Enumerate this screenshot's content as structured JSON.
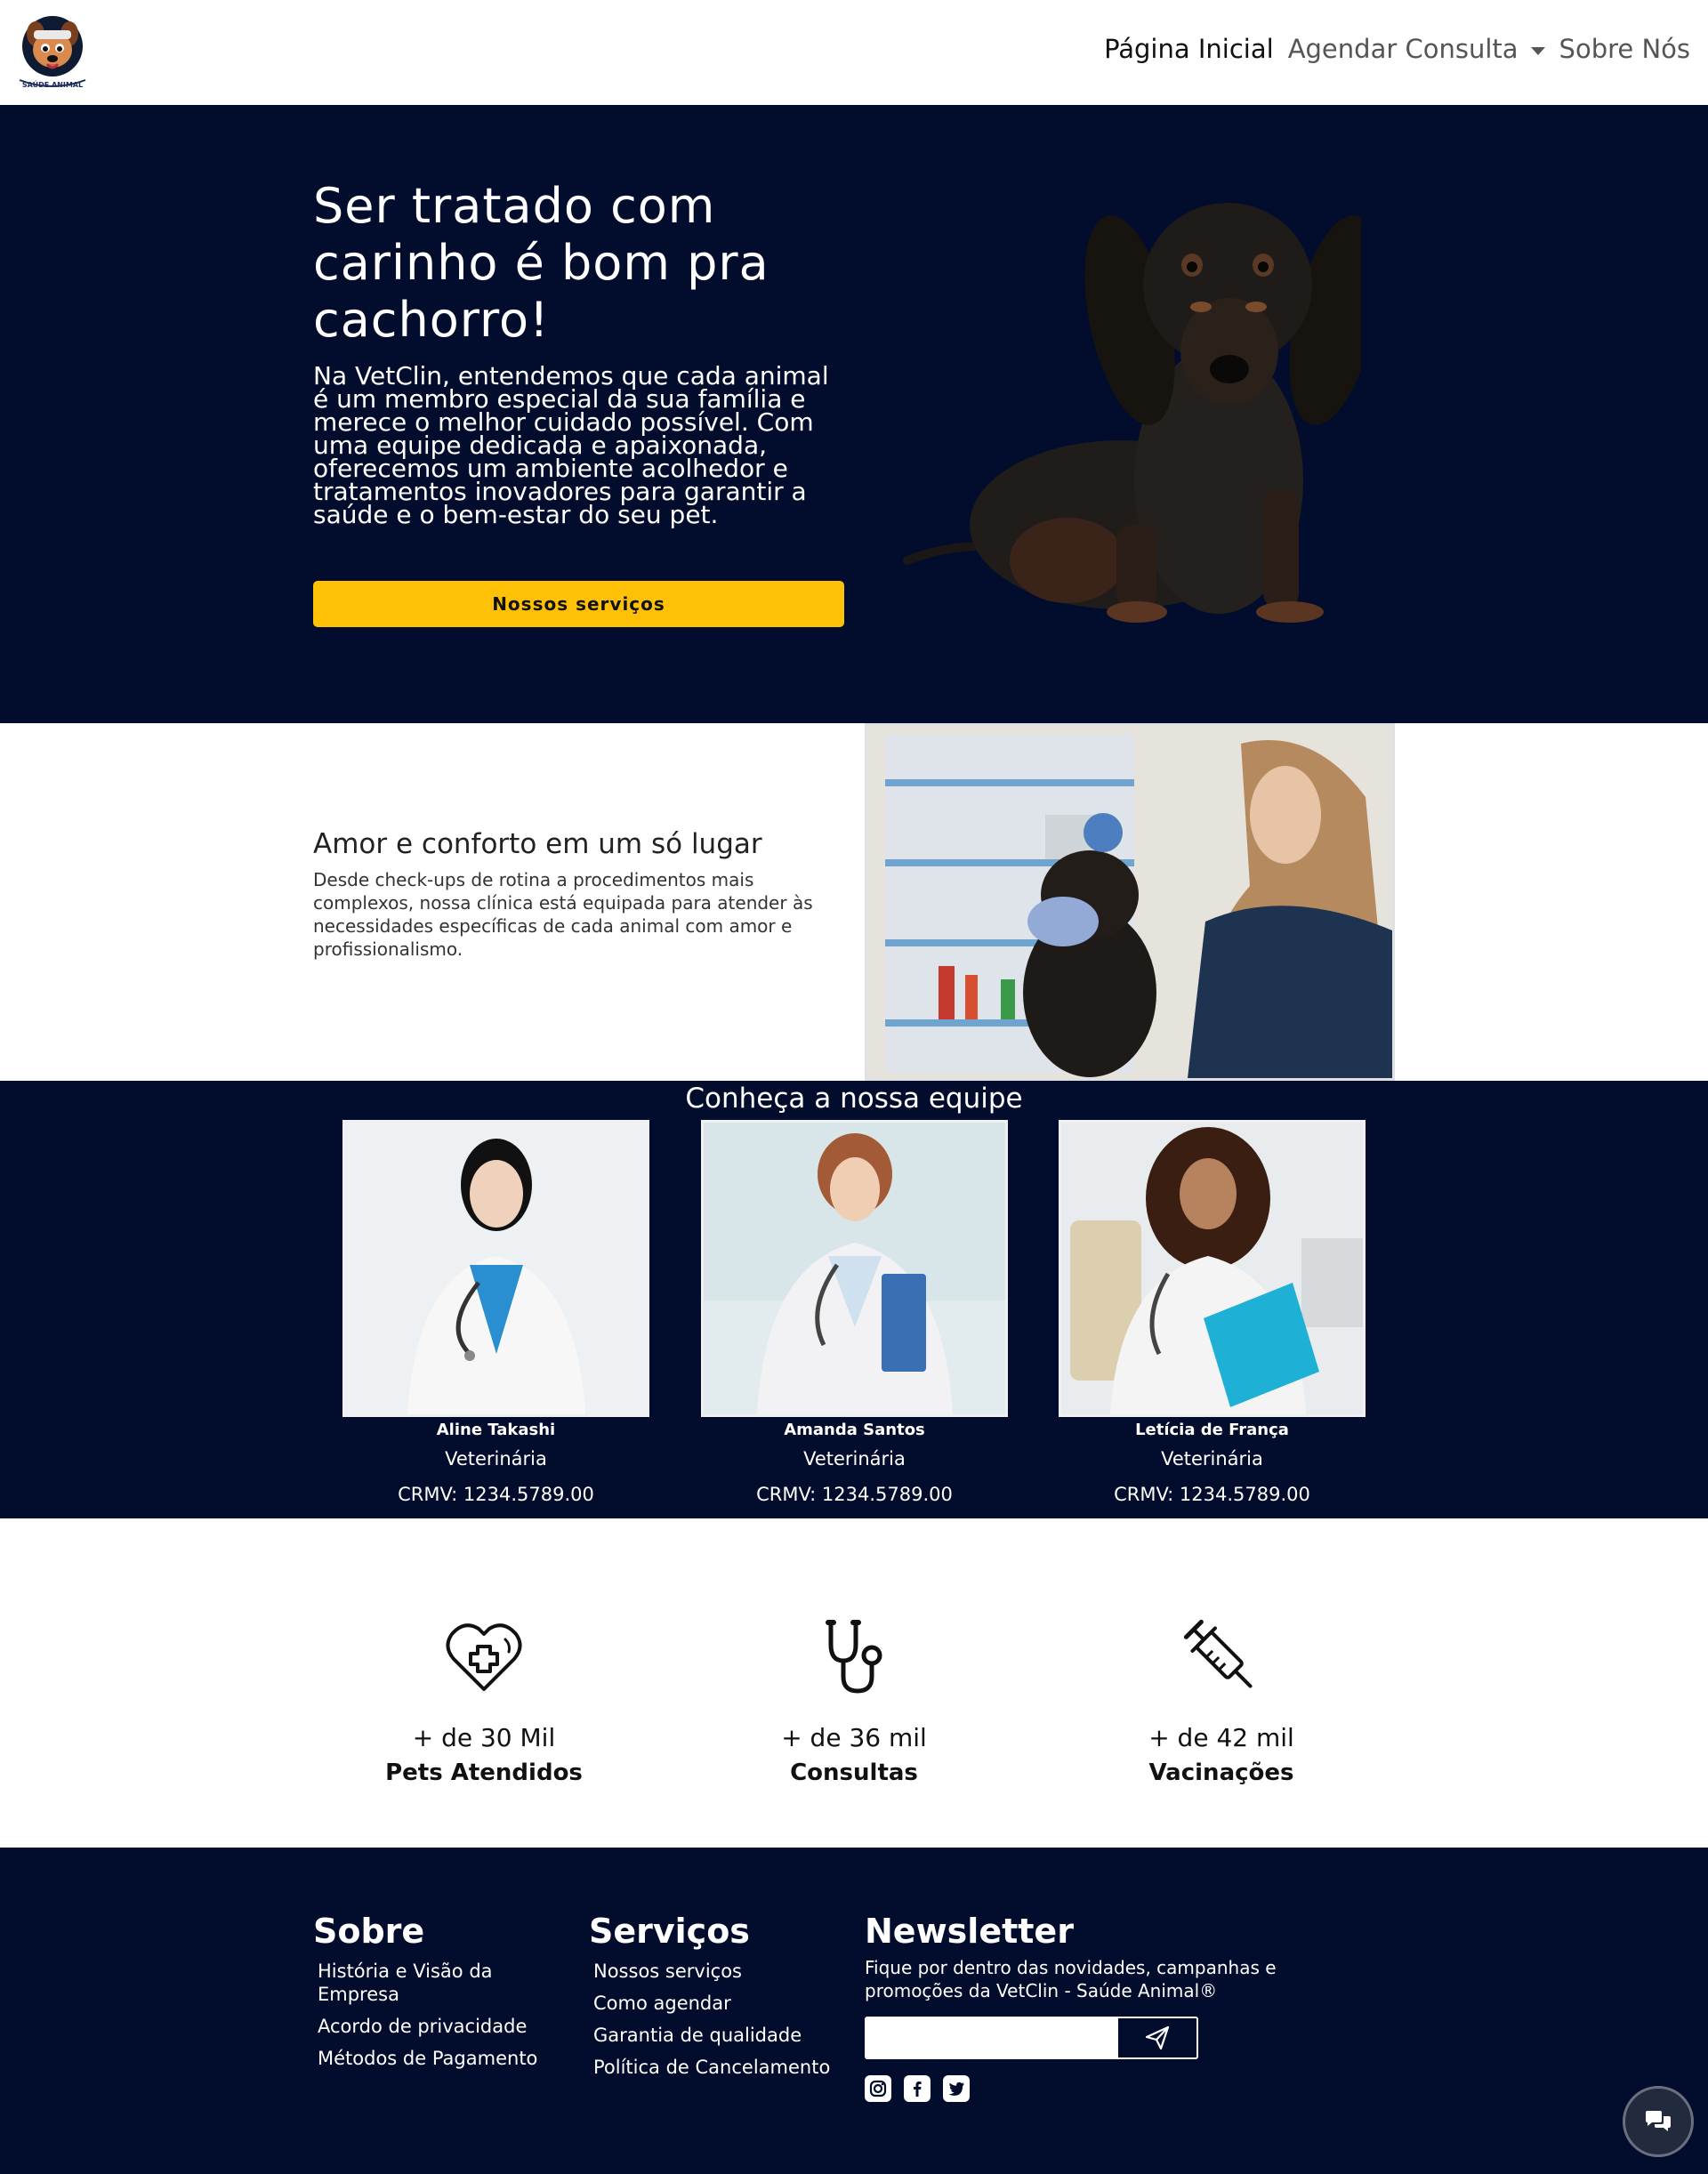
{
  "brand": {
    "logo_text": "SAÚDE ANIMAL"
  },
  "nav": {
    "home": "Página Inicial",
    "schedule": "Agendar Consulta",
    "about": "Sobre Nós"
  },
  "hero": {
    "title": "Ser tratado com carinho é bom pra cachorro!",
    "text": "Na VetClin, entendemos que cada animal é um membro especial da sua família e merece o melhor cuidado possível. Com uma equipe dedicada e apaixonada, oferecemos um ambiente acolhedor e tratamentos inovadores para garantir a saúde e o bem-estar do seu pet.",
    "button": "Nossos serviços"
  },
  "about": {
    "title": "Amor e conforto em um só lugar",
    "text": "Desde check-ups de rotina a procedimentos mais complexos, nossa clínica está equipada para atender às necessidades específicas de cada animal com amor e profissionalismo."
  },
  "team": {
    "title": "Conheça a nossa equipe",
    "members": [
      {
        "name": "Aline Takashi",
        "role": "Veterinária",
        "crmv": "CRMV: 1234.5789.00"
      },
      {
        "name": "Amanda Santos",
        "role": "Veterinária",
        "crmv": "CRMV: 1234.5789.00"
      },
      {
        "name": "Letícia de França",
        "role": "Veterinária",
        "crmv": "CRMV: 1234.5789.00"
      }
    ]
  },
  "stats": [
    {
      "icon": "heart-cross-icon",
      "number": "+ de 30 Mil",
      "label": "Pets Atendidos"
    },
    {
      "icon": "stethoscope-icon",
      "number": "+ de 36 mil",
      "label": "Consultas"
    },
    {
      "icon": "syringe-icon",
      "number": "+ de 42 mil",
      "label": "Vacinações"
    }
  ],
  "footer": {
    "about": {
      "title": "Sobre",
      "links": [
        "História e Visão da Empresa",
        "Acordo de privacidade",
        "Métodos de Pagamento"
      ]
    },
    "services": {
      "title": "Serviços",
      "links": [
        "Nossos serviços",
        "Como agendar",
        "Garantia de qualidade",
        "Política de Cancelamento"
      ]
    },
    "newsletter": {
      "title": "Newsletter",
      "text": "Fique por dentro das novidades, campanhas e promoções da VetClin - Saúde Animal®",
      "input_value": "",
      "input_placeholder": ""
    },
    "socials": [
      "instagram-icon",
      "facebook-icon",
      "twitter-icon"
    ]
  },
  "colors": {
    "navy": "#020d2d",
    "accent": "#ffc107",
    "white": "#ffffff"
  }
}
